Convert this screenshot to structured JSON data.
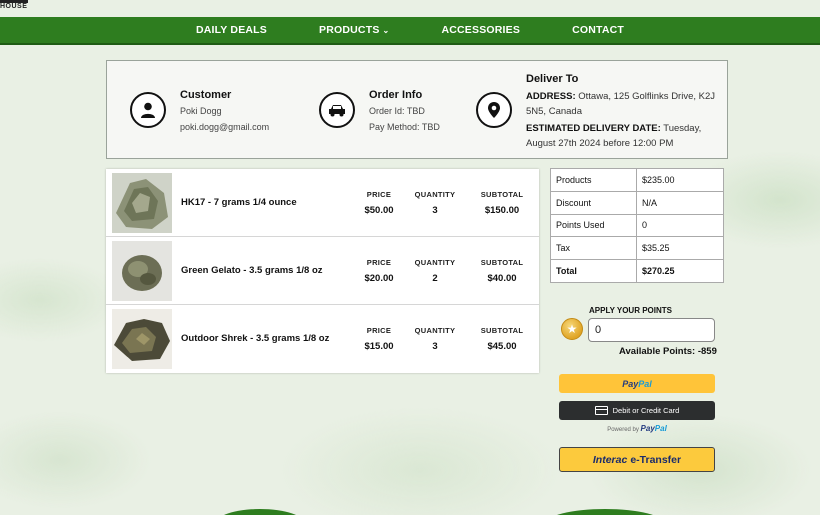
{
  "brand": {
    "logo_text": "HOUSE"
  },
  "nav": {
    "items": [
      {
        "label": "DAILY DEALS"
      },
      {
        "label": "PRODUCTS"
      },
      {
        "label": "ACCESSORIES"
      },
      {
        "label": "CONTACT"
      }
    ],
    "products_chevron": "chevron-down-icon"
  },
  "customer": {
    "title": "Customer",
    "name": "Poki Dogg",
    "email": "poki.dogg@gmail.com",
    "icon": "user-icon"
  },
  "order_info": {
    "title": "Order Info",
    "order_id": "Order Id: TBD",
    "pay_method": "Pay Method: TBD",
    "icon": "car-icon"
  },
  "deliver_to": {
    "title": "Deliver To",
    "address_label": "ADDRESS:",
    "address": "Ottawa, 125 Golflinks Drive, K2J 5N5, Canada",
    "date_label": "ESTIMATED DELIVERY DATE:",
    "date": "Tuesday, August 27th 2024 before 12:00 PM",
    "icon": "location-pin-icon"
  },
  "cart": {
    "col_labels": {
      "price": "PRICE",
      "quantity": "QUANTITY",
      "subtotal": "SUBTOTAL"
    },
    "items": [
      {
        "name": "HK17 - 7 grams 1/4 ounce",
        "price": "$50.00",
        "quantity": "3",
        "subtotal": "$150.00"
      },
      {
        "name": "Green Gelato - 3.5 grams 1/8 oz",
        "price": "$20.00",
        "quantity": "2",
        "subtotal": "$40.00"
      },
      {
        "name": "Outdoor Shrek - 3.5 grams 1/8 oz",
        "price": "$15.00",
        "quantity": "3",
        "subtotal": "$45.00"
      }
    ]
  },
  "summary": {
    "rows": [
      {
        "label": "Products",
        "value": "$235.00"
      },
      {
        "label": "Discount",
        "value": "N/A"
      },
      {
        "label": "Points Used",
        "value": "0"
      },
      {
        "label": "Tax",
        "value": "$35.25"
      },
      {
        "label": "Total",
        "value": "$270.25"
      }
    ]
  },
  "points": {
    "label": "APPLY YOUR POINTS",
    "input_value": "0",
    "available": "Available Points: -859",
    "icon": "star-coin-icon"
  },
  "payment": {
    "paypal_part1": "Pay",
    "paypal_part2": "Pal",
    "card_label": "Debit or Credit Card",
    "powered_by": "Powered by",
    "powered_brand_1": "Pay",
    "powered_brand_2": "Pal",
    "interac_brand": "Interac",
    "interac_label": "e-Transfer"
  },
  "colors": {
    "nav_green": "#2e7d1f",
    "paypal_yellow": "#ffc439",
    "card_black": "#2c2e2f",
    "interac_yellow": "#fcca3d"
  }
}
